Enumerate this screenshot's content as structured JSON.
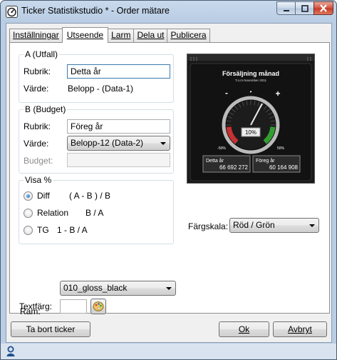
{
  "window": {
    "title": "Ticker Statistikstudio * - Order mätare",
    "controls": [
      "minimize",
      "maximize",
      "close"
    ]
  },
  "tabs": [
    {
      "label": "Inställningar",
      "active": false
    },
    {
      "label": "Utseende",
      "active": true
    },
    {
      "label": "Larm",
      "active": false
    },
    {
      "label": "Dela ut",
      "active": false
    },
    {
      "label": "Publicera",
      "active": false
    }
  ],
  "group_a": {
    "title": "A (Utfall)",
    "rubrik_label": "Rubrik:",
    "rubrik_value": "Detta år",
    "varde_label": "Värde:",
    "varde_value": "Belopp - (Data-1)"
  },
  "group_b": {
    "title": "B (Budget)",
    "rubrik_label": "Rubrik:",
    "rubrik_value": "Föreg år",
    "varde_label": "Värde:",
    "varde_value": "Belopp-12 (Data-2)",
    "budget_label": "Budget:",
    "budget_value": ""
  },
  "visa": {
    "title": "Visa %",
    "options": [
      {
        "label": "Diff",
        "formula": "( A - B ) / B",
        "checked": true
      },
      {
        "label": "Relation",
        "formula": "B / A",
        "checked": false
      },
      {
        "label": "TG",
        "formula": "1 - B / A",
        "checked": false
      }
    ]
  },
  "preview": {
    "title": "Försäljning månad",
    "subtitle": "T.o.m November 2011",
    "minus": "-",
    "plus": "+",
    "dot": "•",
    "percent": "10%",
    "scale_left": "-50%",
    "scale_right": "50%",
    "needle_percent": 10,
    "box1_label": "Detta år",
    "box1_value": "66 692 272",
    "box2_label": "Föreg år",
    "box2_value": "60 164 908",
    "colors": {
      "red": "#d22b2b",
      "green": "#2aa52a",
      "background": "#1a1a1a"
    }
  },
  "fargskala": {
    "label": "Färgskala:",
    "value": "Röd / Grön"
  },
  "ram": {
    "label": "Ram:",
    "value": "010_gloss_black"
  },
  "textfarg": {
    "label": "Textfärg:",
    "value": ""
  },
  "buttons": {
    "remove": "Ta bort ticker",
    "ok": "Ok",
    "cancel": "Avbryt"
  }
}
